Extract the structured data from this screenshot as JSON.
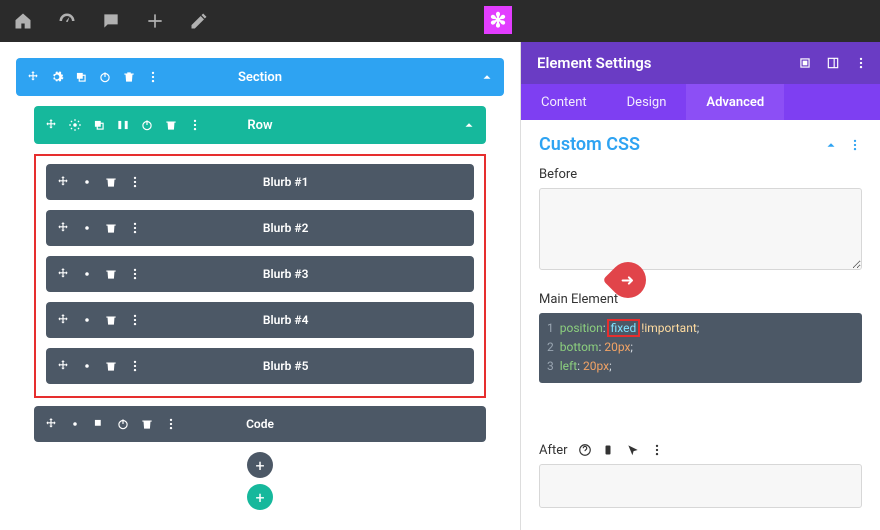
{
  "topbarIcons": [
    "home-icon",
    "dashboard-icon",
    "comment-icon",
    "plus-icon",
    "pencil-icon",
    "brand-icon"
  ],
  "builder": {
    "section": {
      "label": "Section"
    },
    "row": {
      "label": "Row"
    },
    "blurbs": [
      "Blurb #1",
      "Blurb #2",
      "Blurb #3",
      "Blurb #4",
      "Blurb #5"
    ],
    "code": {
      "label": "Code"
    }
  },
  "panel": {
    "title": "Element Settings",
    "tabs": {
      "content": "Content",
      "design": "Design",
      "advanced": "Advanced",
      "active": "advanced"
    },
    "sectionTitle": "Custom CSS",
    "beforeLabel": "Before",
    "mainLabel": "Main Element",
    "afterLabel": "After",
    "code": {
      "l1": {
        "n": "1",
        "prop": "position",
        "val": "fixed",
        "imp": "!important"
      },
      "l2": {
        "n": "2",
        "prop": "bottom",
        "val": "20px"
      },
      "l3": {
        "n": "3",
        "prop": "left",
        "val": "20px"
      }
    }
  }
}
